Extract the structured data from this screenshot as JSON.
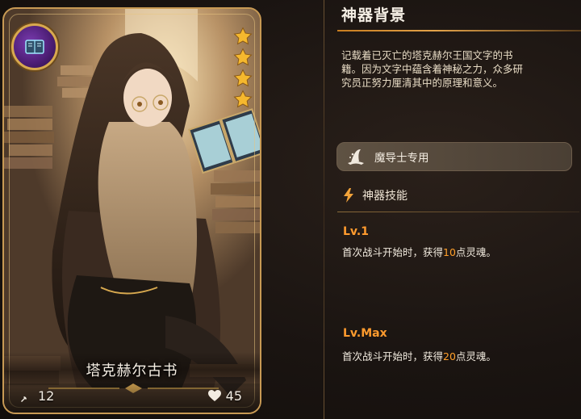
{
  "card": {
    "name": "塔克赫尔古书",
    "stars": 4,
    "attack": "12",
    "health": "45",
    "colors": {
      "frame": "#c89a54",
      "emblem": "#5b2590",
      "star": "#f5b82e"
    }
  },
  "panel": {
    "title": "神器背景",
    "lore": "记载着已灭亡的塔克赫尔王国文字的书籍。因为文字中蕴含着神秘之力，众多研究员正努力厘清其中的原理和意义。",
    "class_restriction": "魔导士专用",
    "skills_header": "神器技能",
    "levels": [
      {
        "label": "Lv.1",
        "desc_pre": "首次战斗开始时，获得",
        "value": "10",
        "desc_post": "点灵魂。"
      },
      {
        "label": "Lv.Max",
        "desc_pre": "首次战斗开始时，获得",
        "value": "20",
        "desc_post": "点灵魂。"
      }
    ],
    "colors": {
      "accent": "#ff9b2e",
      "text": "#f2ebdf"
    }
  }
}
